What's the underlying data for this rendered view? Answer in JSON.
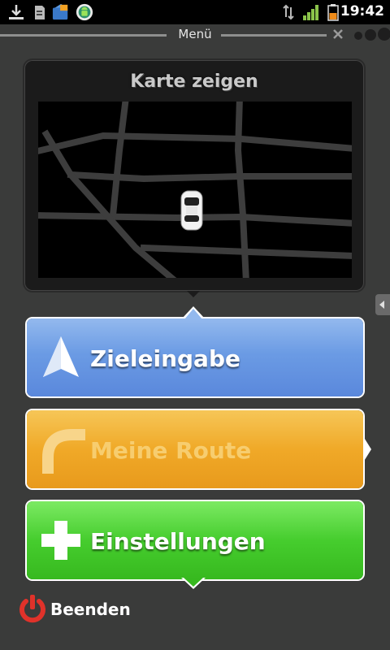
{
  "status_bar": {
    "time": "19:42",
    "icons": [
      "download-icon",
      "sd-card-icon",
      "app-store-icon",
      "android-icon",
      "data-transfer-icon",
      "signal-icon",
      "battery-icon"
    ],
    "colors": {
      "signal": "#8bc34a",
      "battery": "#f08c1a"
    }
  },
  "titlebar": {
    "title": "Menü"
  },
  "map_card": {
    "title": "Karte zeigen",
    "icons": [
      "map-icon",
      "car-icon"
    ]
  },
  "menu": {
    "buttons": [
      {
        "label": "Zieleingabe",
        "icon": "navigation-arrow-icon",
        "color": "#6b9be4",
        "enabled": true
      },
      {
        "label": "Meine Route",
        "icon": "route-curve-icon",
        "color": "#f0a928",
        "enabled": false
      },
      {
        "label": "Einstellungen",
        "icon": "plus-icon",
        "color": "#46cd2e",
        "enabled": true
      }
    ]
  },
  "footer": {
    "quit_label": "Beenden",
    "quit_icon": "power-icon",
    "quit_color": "#e0322a"
  }
}
